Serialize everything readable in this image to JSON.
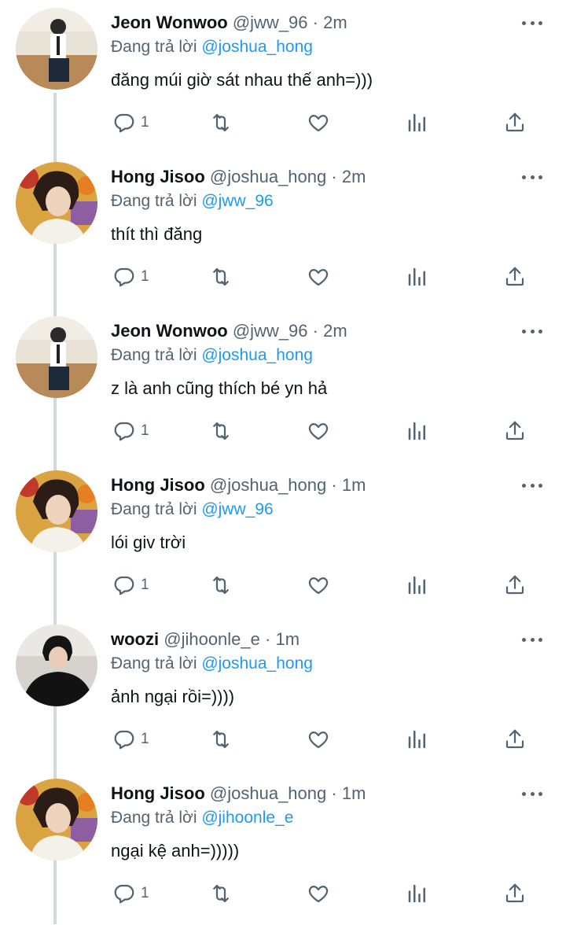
{
  "reply_prefix": "Đang trả lời",
  "tweets": [
    {
      "name": "Jeon Wonwoo",
      "handle": "@jww_96",
      "sep": "·",
      "time": "2m",
      "reply_to": "@joshua_hong",
      "text": "đăng múi giờ sát nhau thế anh=)))",
      "reply_count": "1",
      "avatar": "wonwoo"
    },
    {
      "name": "Hong Jisoo",
      "handle": "@joshua_hong",
      "sep": "·",
      "time": "2m",
      "reply_to": "@jww_96",
      "text": "thít thì đăng",
      "reply_count": "1",
      "avatar": "jisoo"
    },
    {
      "name": "Jeon Wonwoo",
      "handle": "@jww_96",
      "sep": "·",
      "time": "2m",
      "reply_to": "@joshua_hong",
      "text": "z là anh cũng thích bé yn hả",
      "reply_count": "1",
      "avatar": "wonwoo"
    },
    {
      "name": "Hong Jisoo",
      "handle": "@joshua_hong",
      "sep": "·",
      "time": "1m",
      "reply_to": "@jww_96",
      "text": "lói giv trời",
      "reply_count": "1",
      "avatar": "jisoo"
    },
    {
      "name": "woozi",
      "handle": "@jihoonle_e",
      "sep": "·",
      "time": "1m",
      "reply_to": "@joshua_hong",
      "text": "ảnh ngại rồi=))))",
      "reply_count": "1",
      "avatar": "woozi"
    },
    {
      "name": "Hong Jisoo",
      "handle": "@joshua_hong",
      "sep": "·",
      "time": "1m",
      "reply_to": "@jihoonle_e",
      "text": "ngại kệ anh=)))))",
      "reply_count": "1",
      "avatar": "jisoo"
    }
  ],
  "icons": {
    "reply": "reply-icon",
    "retweet": "retweet-icon",
    "like": "heart-icon",
    "stats": "stats-icon",
    "share": "share-icon",
    "more": "more-icon"
  },
  "colors": {
    "link": "#1d9bf0",
    "secondary": "#536471",
    "text": "#0f1419",
    "thread_line": "#cfd9de"
  }
}
